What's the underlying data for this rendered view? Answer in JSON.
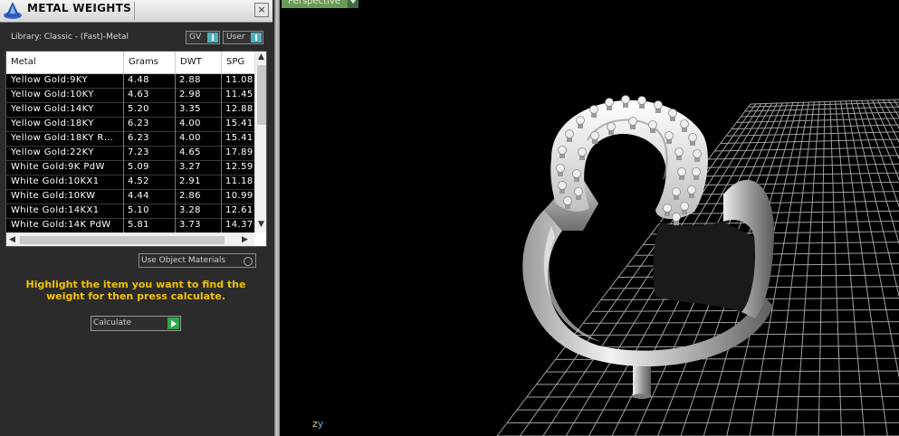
{
  "panel": {
    "title": "METAL WEIGHTS",
    "close_glyph": "×",
    "library": "Library: Classic - (Fast)-Metal",
    "gv_select": "GV",
    "user_select": "User",
    "columns": [
      "Metal",
      "Grams",
      "DWT",
      "SPG"
    ],
    "rows": [
      [
        "Yellow Gold:9KY",
        "4.48",
        "2.88",
        "11.08"
      ],
      [
        "Yellow Gold:10KY",
        "4.63",
        "2.98",
        "11.45"
      ],
      [
        "Yellow Gold:14KY",
        "5.20",
        "3.35",
        "12.88"
      ],
      [
        "Yellow Gold:18KY",
        "6.23",
        "4.00",
        "15.41"
      ],
      [
        "Yellow Gold:18KY R…",
        "6.23",
        "4.00",
        "15.41"
      ],
      [
        "Yellow Gold:22KY",
        "7.23",
        "4.65",
        "17.89"
      ],
      [
        "White Gold:9K PdW",
        "5.09",
        "3.27",
        "12.59"
      ],
      [
        "White Gold:10KX1",
        "4.52",
        "2.91",
        "11.18"
      ],
      [
        "White Gold:10KW",
        "4.44",
        "2.86",
        "10.99"
      ],
      [
        "White Gold:14KX1",
        "5.10",
        "3.28",
        "12.61"
      ],
      [
        "White Gold:14K PdW",
        "5.81",
        "3.73",
        "14.37"
      ]
    ],
    "use_object_materials": "Use Object Materials",
    "instruction": "Highlight the item you want to find the weight for then press calculate.",
    "calculate_label": "Calculate"
  },
  "viewport": {
    "view_label": "Perspective",
    "axis_z": "z",
    "axis_y": "y"
  },
  "colors": {
    "instruction_text": "#f2c200",
    "view_tab": "#6a9a5a",
    "calc_go": "#31a84a",
    "select_arrow": "#4fb0c0"
  },
  "icons": [
    "app-logo-icon",
    "close-icon",
    "dropdown-arrow-icon",
    "scroll-up-arrow-icon",
    "scroll-down-arrow-icon",
    "scroll-left-arrow-icon",
    "scroll-right-arrow-icon",
    "radio-icon",
    "play-icon"
  ]
}
